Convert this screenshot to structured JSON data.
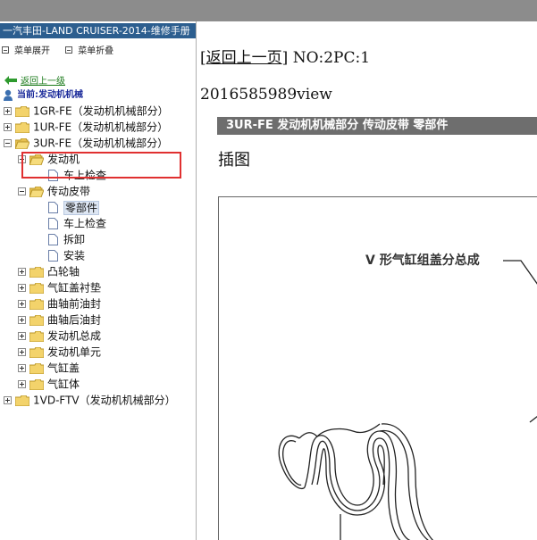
{
  "tree_pane": {
    "title": "一汽丰田-LAND CRUISER-2014-维修手册",
    "menu": {
      "expand": "菜单展开",
      "collapse": "菜单折叠"
    },
    "back_link": "返回上一级",
    "current": "当前:发动机机械",
    "items": [
      {
        "label": "1GR-FE（发动机机械部分）"
      },
      {
        "label": "1UR-FE（发动机机械部分）"
      },
      {
        "label": "3UR-FE（发动机机械部分）"
      },
      {
        "label": "发动机"
      },
      {
        "label": "车上检查"
      },
      {
        "label": "传动皮带"
      },
      {
        "label": "零部件"
      },
      {
        "label": "车上检查"
      },
      {
        "label": "拆卸"
      },
      {
        "label": "安装"
      },
      {
        "label": "凸轮轴"
      },
      {
        "label": "气缸盖衬垫"
      },
      {
        "label": "曲轴前油封"
      },
      {
        "label": "曲轴后油封"
      },
      {
        "label": "发动机总成"
      },
      {
        "label": "发动机单元"
      },
      {
        "label": "气缸盖"
      },
      {
        "label": "气缸体"
      },
      {
        "label": "1VD-FTV（发动机机械部分）"
      }
    ]
  },
  "content": {
    "nav_bracket_open": "[",
    "nav_back": "返回上一页",
    "nav_bracket_close": "]",
    "nav_id": "NO:2PC:1",
    "views": "2016585989view",
    "section_header": "3UR-FE 发动机机械部分  传动皮带  零部件",
    "section_title": "插图",
    "figure_callout": "V 形气缸组盖分总成"
  },
  "colors": {
    "title_bar": "#2c5e8f",
    "section_bar": "#6e6e6e",
    "highlight": "#e03030",
    "link_green": "#1a7a1a",
    "current_blue": "#1a2a9a"
  }
}
